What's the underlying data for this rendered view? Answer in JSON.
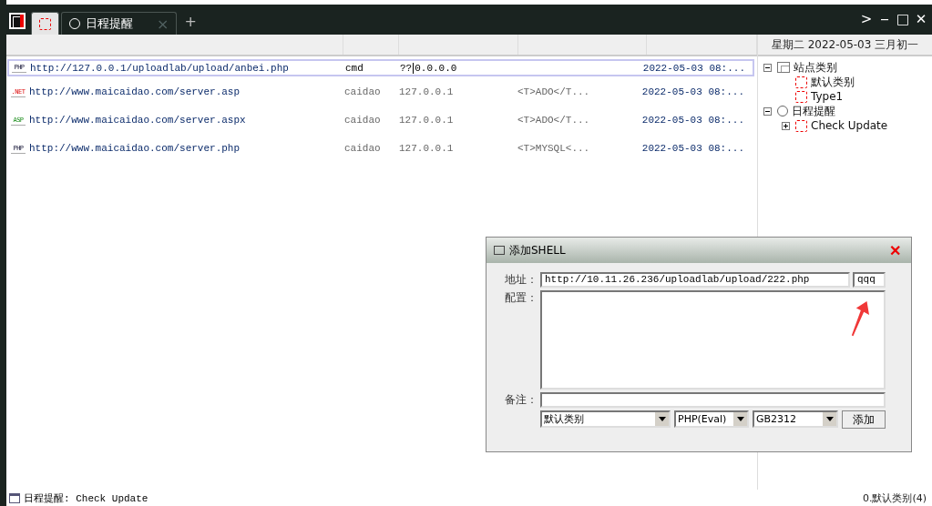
{
  "tabs": [
    {
      "kind": "sites",
      "selected": true
    },
    {
      "kind": "schedule",
      "label": "日程提醒",
      "close": "×",
      "selected": false
    }
  ],
  "new_tab": "+",
  "window_controls": [
    ">",
    "‒",
    "□",
    "✕"
  ],
  "table": {
    "rows": [
      {
        "kind": "php",
        "type": "PHP",
        "url": "http://127.0.0.1/uploadlab/upload/anbei.php",
        "password": "cmd",
        "ip": "??",
        "ip_edit": "0.0.0.0",
        "note": "",
        "time": "2022-05-03 08:...",
        "selected": true
      },
      {
        "kind": "net",
        "type": ".NET",
        "url": "http://www.maicaidao.com/server.asp",
        "password": "caidao",
        "ip": "127.0.0.1",
        "note": "<T>ADO</T...",
        "time": "2022-05-03 08:...",
        "selected": false
      },
      {
        "kind": "asp",
        "type": "ASP",
        "url": "http://www.maicaidao.com/server.aspx",
        "password": "caidao",
        "ip": "127.0.0.1",
        "note": "<T>ADO</T...",
        "time": "2022-05-03 08:...",
        "selected": false
      },
      {
        "kind": "php",
        "type": "PHP",
        "url": "http://www.maicaidao.com/server.php",
        "password": "caidao",
        "ip": "127.0.0.1",
        "note": "<T>MYSQL<...",
        "time": "2022-05-03 08:...",
        "selected": false
      }
    ]
  },
  "sidebar": {
    "date": "星期二 2022-05-03 三月初一",
    "tree": [
      {
        "label": "站点类别",
        "kind": "folder",
        "expanded": true,
        "children": [
          {
            "label": "默认类别",
            "kind": "item"
          },
          {
            "label": "Type1",
            "kind": "item"
          }
        ]
      },
      {
        "label": "日程提醒",
        "kind": "clock",
        "expanded": true,
        "children": [
          {
            "label": "Check Update",
            "kind": "item",
            "expanded": false
          }
        ]
      }
    ]
  },
  "dialog": {
    "title": "添加SHELL",
    "close": "✕",
    "address_label": "地址：",
    "address": "http://10.11.26.236/uploadlab/upload/222.php",
    "password": "qqq",
    "config_label": "配置：",
    "note_label": "备注：",
    "selects": [
      "默认类别",
      "PHP(Eval)",
      "GB2312"
    ],
    "add_button": "添加"
  },
  "status_bar": {
    "left": "日程提醒: Check Update",
    "right": "0.默认类别(4)"
  }
}
